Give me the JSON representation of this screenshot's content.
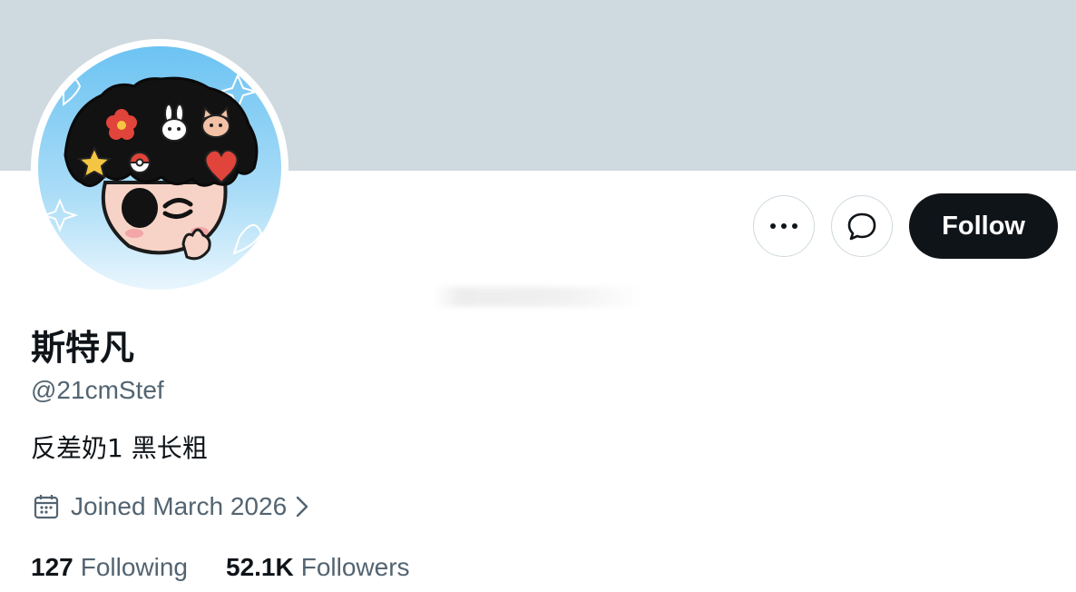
{
  "profile": {
    "display_name": "斯特凡",
    "handle": "@21cmStef",
    "bio": "反差奶1 黑长粗",
    "joined": "Joined March 2026"
  },
  "actions": {
    "follow_label": "Follow",
    "more_icon": "more-horizontal-icon",
    "message_icon": "chat-bubble-icon"
  },
  "stats": {
    "following_count": "127",
    "following_label": "Following",
    "followers_count": "52.1K",
    "followers_label": "Followers"
  },
  "colors": {
    "banner": "#cfd9e0",
    "primary_text": "#0f1419",
    "secondary_text": "#536471",
    "follow_bg": "#0f1419"
  }
}
